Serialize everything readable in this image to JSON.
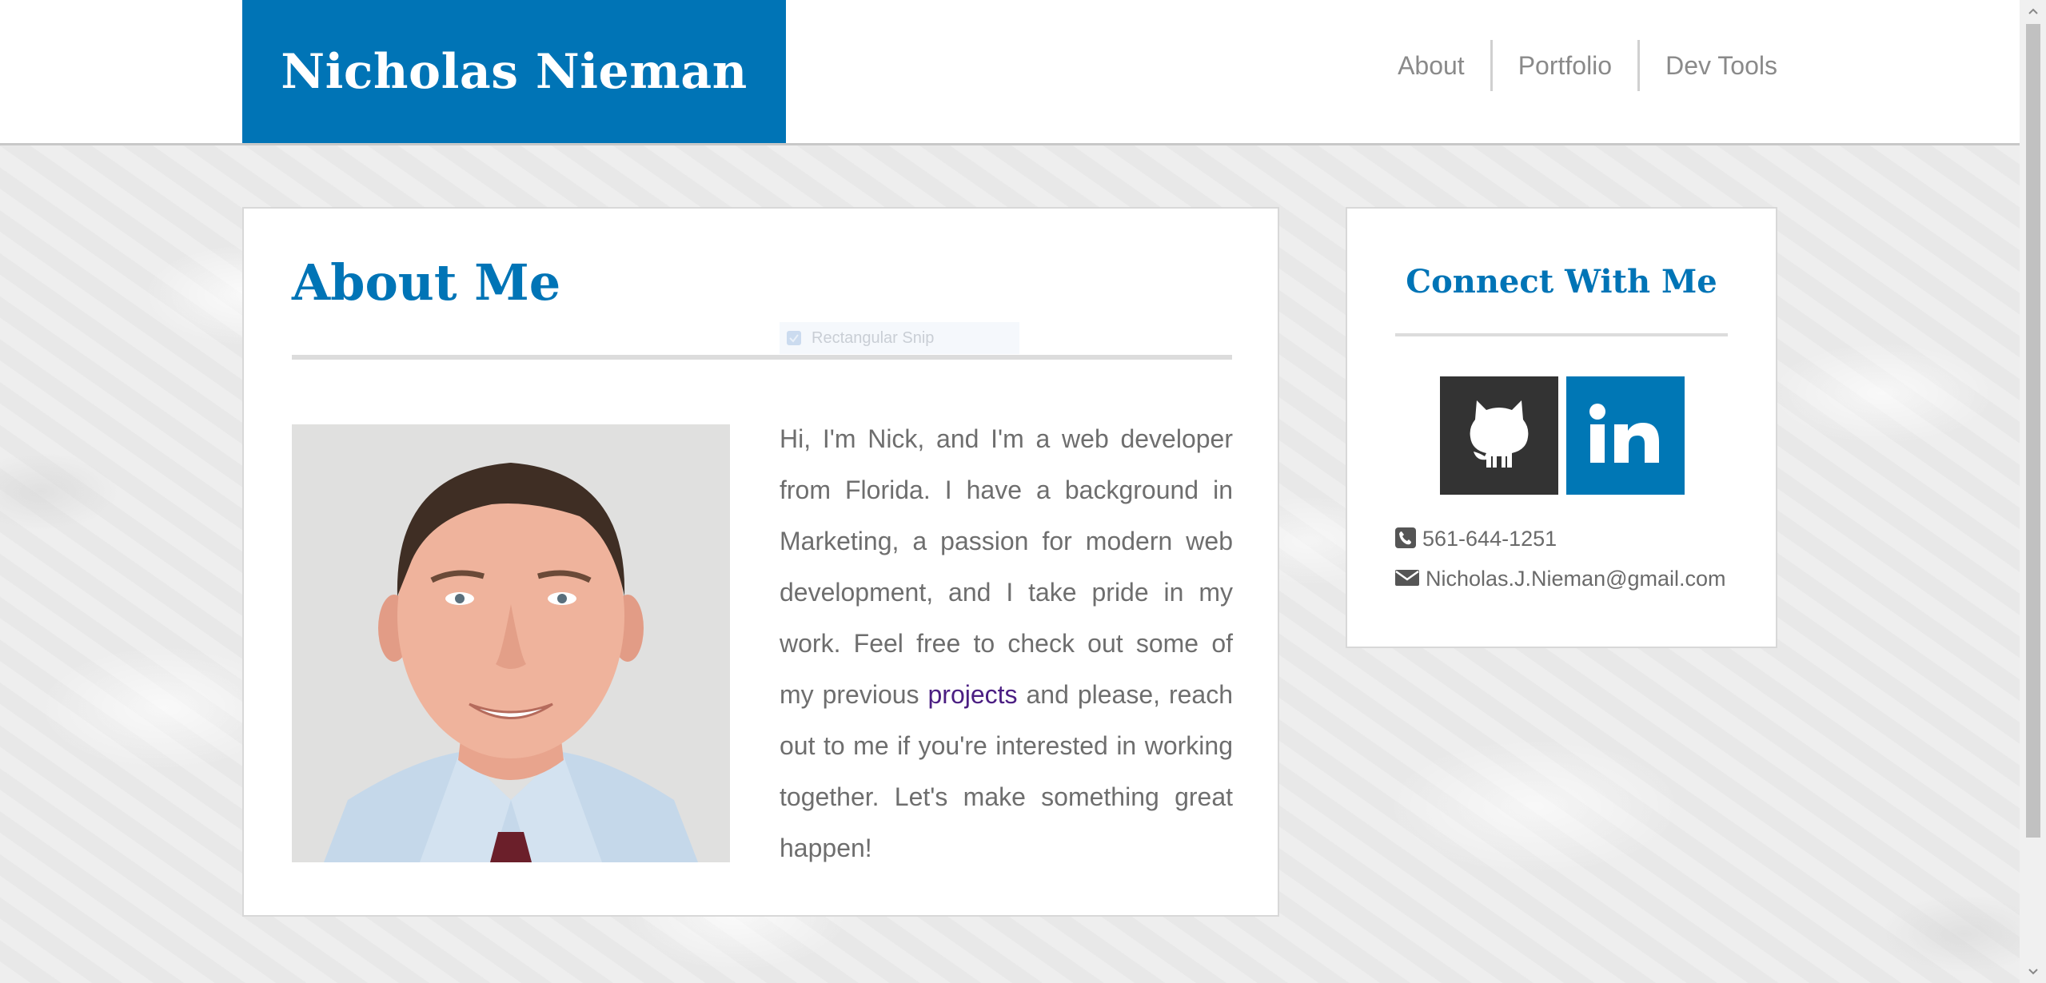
{
  "header": {
    "brand": "Nicholas Nieman",
    "nav": [
      {
        "label": "About"
      },
      {
        "label": "Portfolio"
      },
      {
        "label": "Dev Tools"
      }
    ]
  },
  "about": {
    "title": "About Me",
    "text_before_link": "Hi, I'm Nick, and I'm a web developer from Florida. I have a background in Marketing, a passion for modern web development, and I take pride in my work. Feel free to check out some of my previous ",
    "link_text": "projects",
    "text_after_link": " and please, reach out to me if you're interested in working together. Let's make something great happen!"
  },
  "snip_overlay": {
    "label": "Rectangular Snip"
  },
  "connect": {
    "title": "Connect With Me",
    "social": [
      {
        "name": "github",
        "icon": "github-icon"
      },
      {
        "name": "linkedin",
        "icon": "linkedin-icon",
        "glyph": "in"
      }
    ],
    "phone": "561-644-1251",
    "email": "Nicholas.J.Nieman@gmail.com"
  },
  "colors": {
    "brand_blue": "#0074b6",
    "linkedin_blue": "#0077b5",
    "github_dark": "#333333",
    "link_purple": "#4b1e82"
  }
}
